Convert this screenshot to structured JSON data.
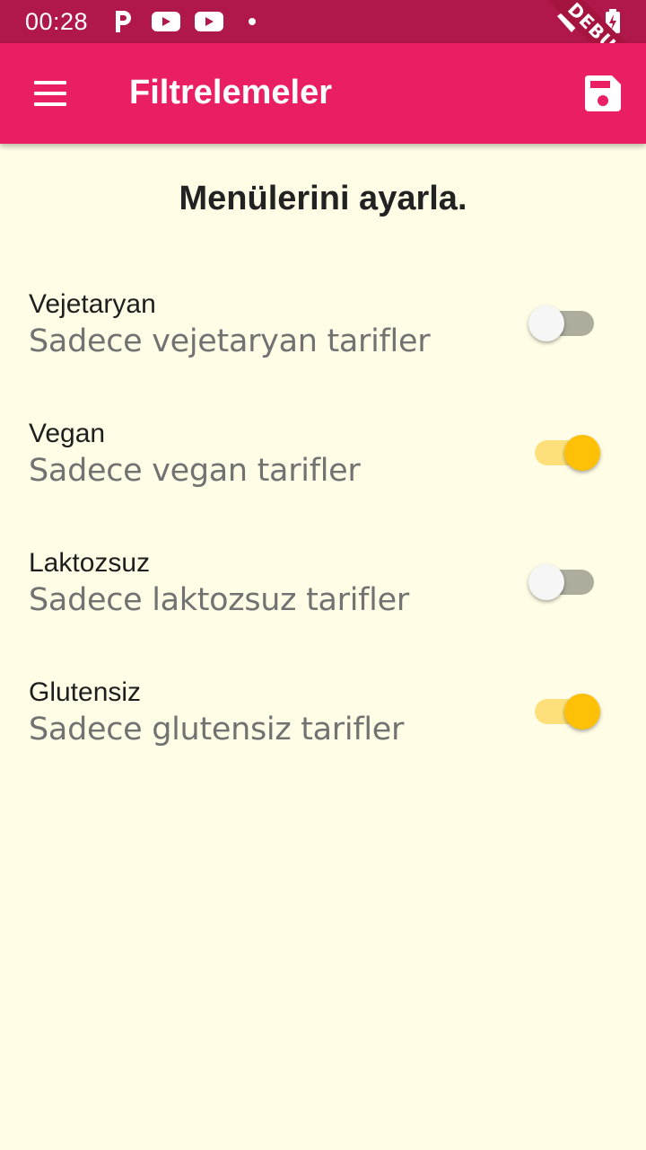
{
  "status_bar": {
    "time": "00:28",
    "debug_label": "DEBUG",
    "icons": [
      "p-notification-icon",
      "youtube-icon",
      "youtube-icon",
      "dot-icon",
      "wifi-icon",
      "battery-charging-icon"
    ]
  },
  "app_bar": {
    "title": "Filtrelemeler",
    "menu_icon": "menu-icon",
    "save_icon": "save-icon"
  },
  "page": {
    "heading": "Menülerini ayarla."
  },
  "filters": [
    {
      "title": "Vejetaryan",
      "subtitle": "Sadece vejetaryan tarifler",
      "enabled": false
    },
    {
      "title": "Vegan",
      "subtitle": "Sadece vegan tarifler",
      "enabled": true
    },
    {
      "title": "Laktozsuz",
      "subtitle": "Sadece laktozsuz tarifler",
      "enabled": false
    },
    {
      "title": "Glutensiz",
      "subtitle": "Sadece glutensiz tarifler",
      "enabled": true
    }
  ],
  "colors": {
    "status_bar": "#b0174b",
    "app_bar": "#e91e63",
    "background": "#fffde6",
    "switch_on_thumb": "#ffc107",
    "switch_on_track": "#fde07a",
    "switch_off_thumb": "#f6f6f6",
    "switch_off_track": "#aeac9c"
  }
}
